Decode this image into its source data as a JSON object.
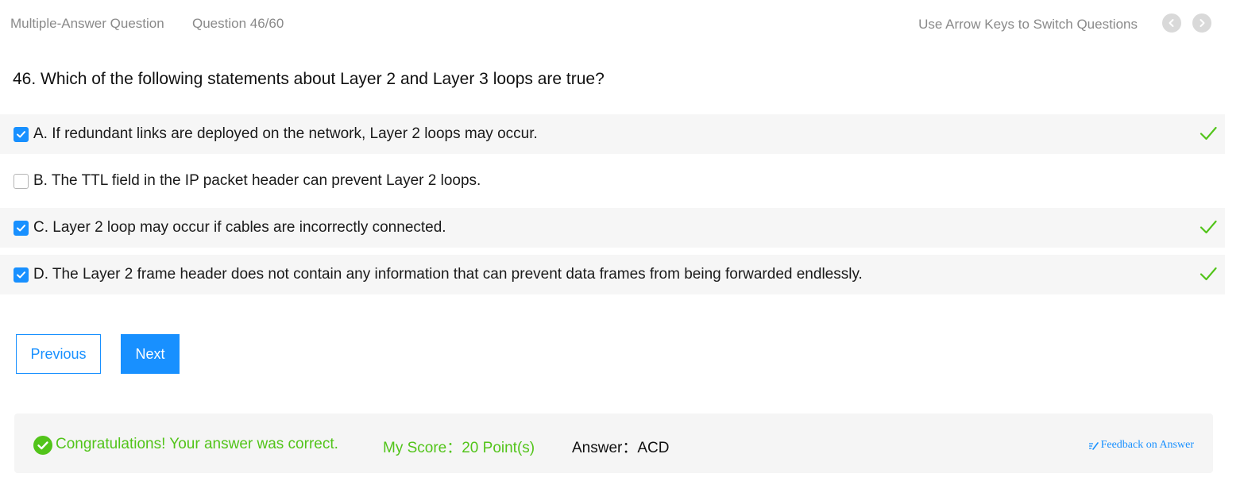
{
  "header": {
    "question_type": "Multiple-Answer Question",
    "question_counter": "Question 46/60",
    "hint": "Use Arrow Keys to Switch Questions",
    "prev_icon": "chevron-left-icon",
    "next_icon": "chevron-right-icon"
  },
  "question": {
    "text": "46. Which of the following statements about Layer 2 and Layer 3 loops are true?"
  },
  "options": [
    {
      "text": "A. If redundant links are deployed on the network, Layer 2 loops may occur.",
      "checked": true,
      "correct": true
    },
    {
      "text": "B. The TTL field in the IP packet header can prevent Layer 2 loops.",
      "checked": false,
      "correct": false
    },
    {
      "text": "C. Layer 2 loop may occur if cables are incorrectly connected.",
      "checked": true,
      "correct": true
    },
    {
      "text": "D. The Layer 2 frame header does not contain any information that can prevent data frames from being forwarded endlessly.",
      "checked": true,
      "correct": true
    }
  ],
  "buttons": {
    "previous": "Previous",
    "next": "Next"
  },
  "result": {
    "message": "Congratulations! Your answer was correct.",
    "score": "My Score：20 Point(s)",
    "answer": "Answer：ACD",
    "feedback": "Feedback on Answer"
  },
  "colors": {
    "accent": "#1890ff",
    "success": "#52c41a",
    "muted": "#8a8a8a"
  }
}
